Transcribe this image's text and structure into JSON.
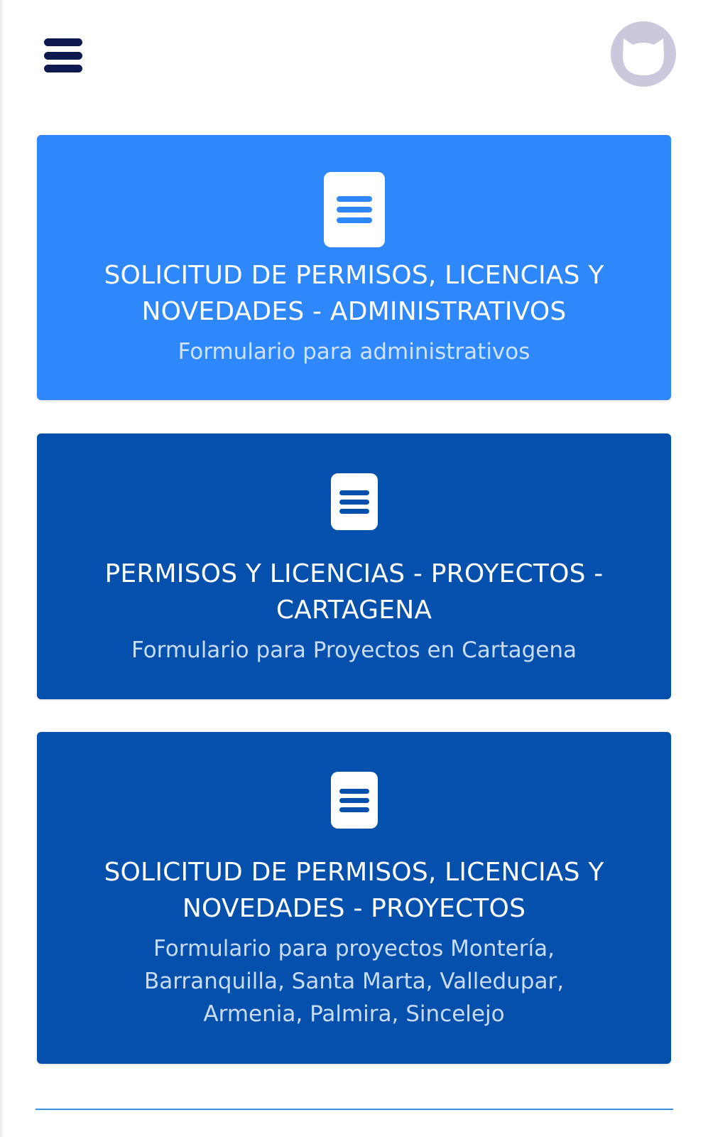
{
  "header": {
    "menu_icon": "hamburger-menu-icon",
    "avatar_icon": "cat-avatar-icon"
  },
  "cards": [
    {
      "title": "SOLICITUD DE PERMISOS, LICENCIAS Y NOVEDADES - ADMINISTRATIVOS",
      "subtitle": "Formulario para administrativos",
      "icon": "document-icon",
      "color": "#2f88fb"
    },
    {
      "title": "PERMISOS Y LICENCIAS - PROYECTOS - CARTAGENA",
      "subtitle": "Formulario para Proyectos en Cartagena",
      "icon": "document-icon",
      "color": "#0550ac"
    },
    {
      "title": "SOLICITUD DE PERMISOS, LICENCIAS Y NOVEDADES - PROYECTOS",
      "subtitle": "Formulario para proyectos Montería, Barranquilla, Santa Marta, Valledupar, Armenia, Palmira, Sincelejo",
      "icon": "document-icon",
      "color": "#0550ac"
    }
  ],
  "colors": {
    "menu_icon": "#0e1a4f",
    "avatar": "#c9c8dc",
    "divider": "#3a8ed8"
  }
}
